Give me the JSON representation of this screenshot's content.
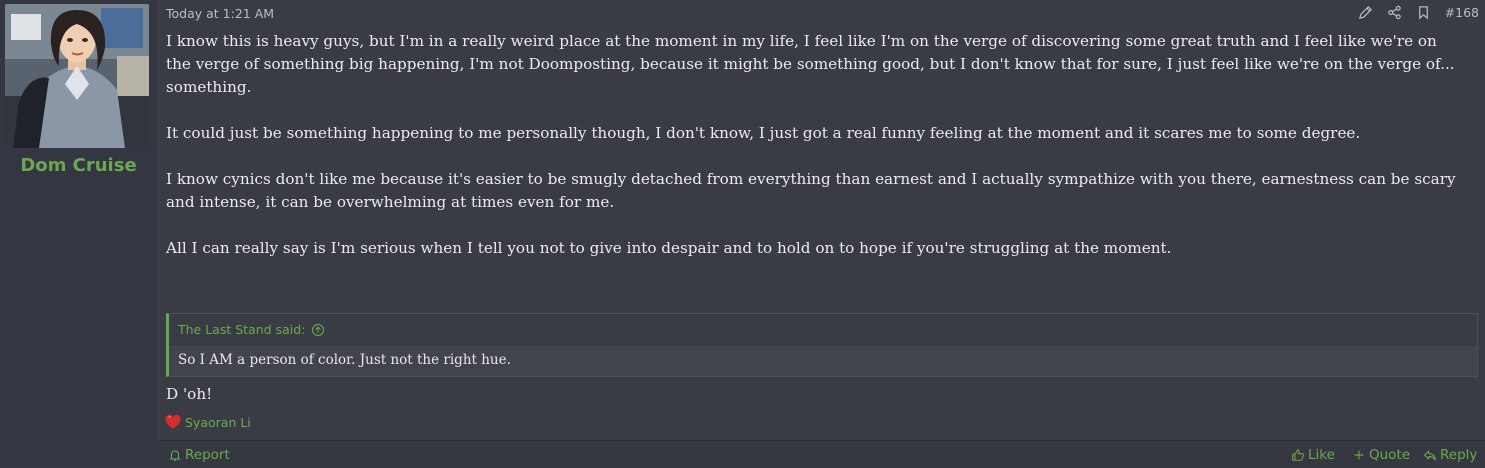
{
  "author": {
    "name": "Dom Cruise"
  },
  "post": {
    "timestamp": "Today at 1:21 AM",
    "number": "#168",
    "paragraphs": [
      "I know this is heavy guys, but I'm in a really weird place at the moment in my life, I feel like I'm on the verge of discovering some great truth and I feel like we're on the verge of something big happening, I'm not Doomposting, because it might be something good, but I don't know that for sure, I just feel like we're on the verge of... something.",
      "It could just be something happening to me personally though, I don't know, I just got a real funny feeling at the moment and it scares me to some degree.",
      "I know cynics don't like me because it's easier to be smugly detached from everything than earnest and I actually sympathize with you there, earnestness can be scary and intense, it can be overwhelming at times even for me.",
      "All I can really say is I'm serious when I tell you not to give into despair and to hold on to hope if you're struggling at the moment."
    ]
  },
  "quote": {
    "header": "The Last Stand said:",
    "text": "So I AM a person of color. Just not the right hue."
  },
  "reply": {
    "text": "D 'oh!"
  },
  "reactions": {
    "users": "Syaoran Li",
    "icon": "heart-icon"
  },
  "footer": {
    "report_label": "Report",
    "like_label": "Like",
    "quote_label": "Quote",
    "reply_label": "Reply"
  },
  "colors": {
    "accent": "#6aa84f",
    "background": "#393c45",
    "sidebar": "#343741",
    "text": "#ececec"
  }
}
